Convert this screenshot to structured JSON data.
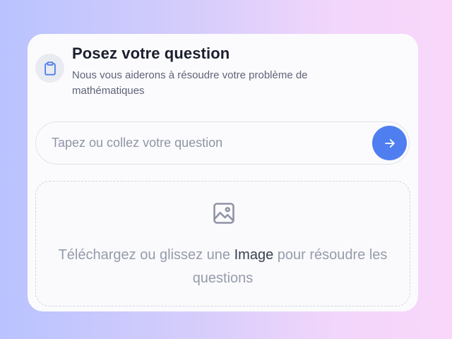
{
  "header": {
    "icon": "clipboard-icon",
    "title": "Posez votre question",
    "subtitle": "Nous vous aiderons à résoudre votre problème de mathématiques"
  },
  "question": {
    "value": "",
    "placeholder": "Tapez ou collez votre question",
    "send_icon": "arrow-right-icon"
  },
  "upload": {
    "icon": "image-icon",
    "text_before": "Téléchargez ou glissez une ",
    "text_highlight": "Image",
    "text_after": " pour résoudre les questions"
  },
  "colors": {
    "accent": "#4f7ef0",
    "title": "#1b1f2d",
    "muted": "#969cac"
  }
}
